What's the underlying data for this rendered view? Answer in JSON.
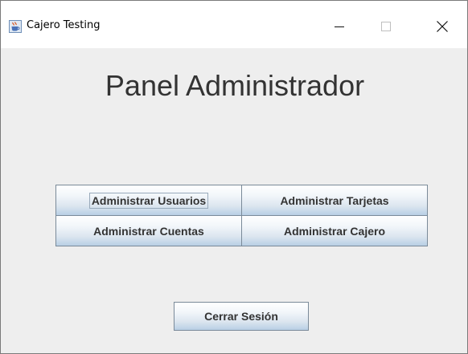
{
  "window": {
    "title": "Cajero Testing",
    "icon": "java-coffee-cup-icon",
    "controls": {
      "minimize_icon": "minimize-icon",
      "maximize_icon": "maximize-icon",
      "close_icon": "close-icon"
    }
  },
  "panel": {
    "heading": "Panel Administrador",
    "buttons": [
      {
        "label": "Administrar Usuarios",
        "focused": true
      },
      {
        "label": "Administrar Tarjetas"
      },
      {
        "label": "Administrar Cuentas"
      },
      {
        "label": "Administrar Cajero"
      }
    ],
    "logout_label": "Cerrar Sesión"
  },
  "colors": {
    "window_background": "#eeeeee",
    "titlebar_background": "#ffffff",
    "heading_text": "#333333",
    "button_border": "#7a8a99",
    "button_gradient_bottom": "#b8cfe5"
  }
}
